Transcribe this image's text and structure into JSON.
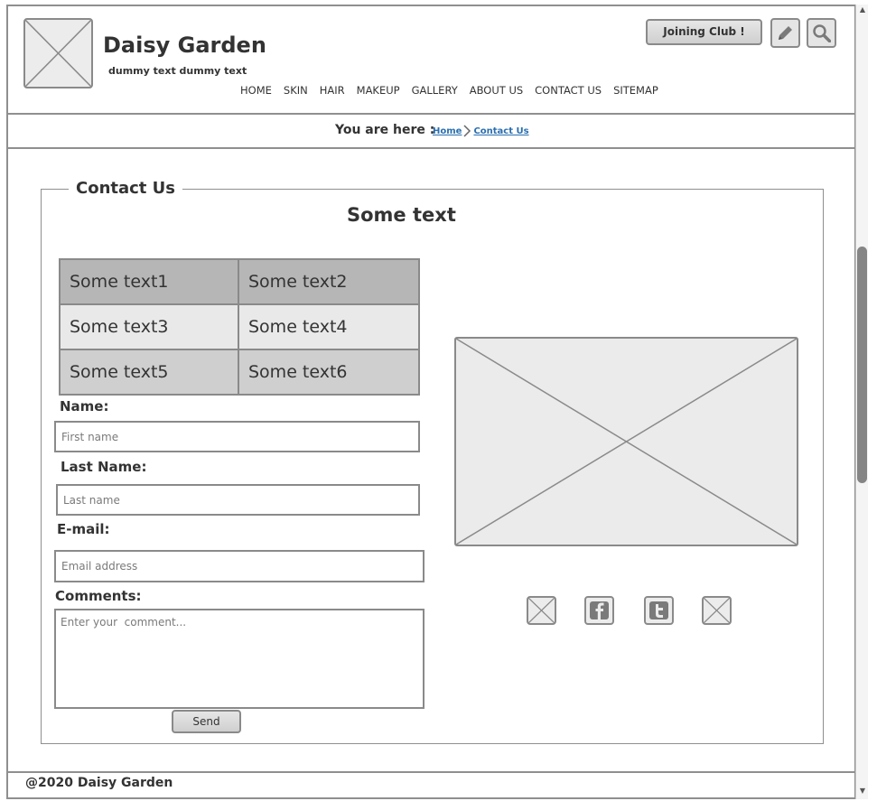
{
  "header": {
    "site_title": "Daisy Garden",
    "tagline": "dummy text dummy text",
    "join_label": "Joining Club !",
    "edit_icon": "pencil-icon",
    "search_icon": "search-icon",
    "nav": [
      "HOME",
      "SKIN",
      "HAIR",
      "MAKEUP",
      "GALLERY",
      "ABOUT US",
      "CONTACT US",
      "SITEMAP"
    ]
  },
  "breadcrumb": {
    "prefix": "You are here :",
    "items": [
      "Home",
      "Contact Us"
    ]
  },
  "contact": {
    "legend": "Contact Us",
    "heading": "Some text",
    "table": [
      [
        "Some text1",
        "Some text2"
      ],
      [
        "Some text3",
        "Some text4"
      ],
      [
        "Some text5",
        "Some text6"
      ]
    ],
    "form": {
      "name_label": "Name:",
      "name_placeholder": "First name",
      "last_label": "Last Name:",
      "last_placeholder": "Last name",
      "email_label": "E-mail:",
      "email_placeholder": "Email address",
      "comments_label": "Comments:",
      "comments_placeholder": "Enter your  comment...",
      "send_label": "Send"
    },
    "social_icons": [
      "image-placeholder-icon",
      "facebook-icon",
      "twitter-icon",
      "image-placeholder-icon"
    ]
  },
  "footer": {
    "copyright": "@2020 Daisy Garden"
  }
}
